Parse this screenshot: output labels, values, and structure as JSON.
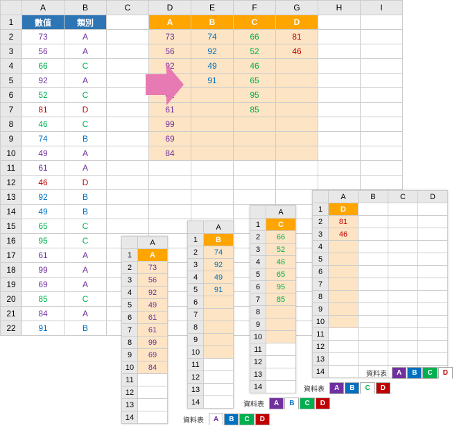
{
  "main": {
    "headers": [
      "數值",
      "類別"
    ],
    "cols": [
      "A",
      "B",
      "C",
      "D",
      "E",
      "F",
      "G",
      "H",
      "I"
    ],
    "rows": [
      {
        "n": "73",
        "c": "A"
      },
      {
        "n": "56",
        "c": "A"
      },
      {
        "n": "66",
        "c": "C"
      },
      {
        "n": "92",
        "c": "A"
      },
      {
        "n": "52",
        "c": "C"
      },
      {
        "n": "81",
        "c": "D"
      },
      {
        "n": "46",
        "c": "C"
      },
      {
        "n": "74",
        "c": "B"
      },
      {
        "n": "49",
        "c": "A"
      },
      {
        "n": "61",
        "c": "A"
      },
      {
        "n": "46",
        "c": "D"
      },
      {
        "n": "92",
        "c": "B"
      },
      {
        "n": "49",
        "c": "B"
      },
      {
        "n": "65",
        "c": "C"
      },
      {
        "n": "95",
        "c": "C"
      },
      {
        "n": "61",
        "c": "A"
      },
      {
        "n": "99",
        "c": "A"
      },
      {
        "n": "69",
        "c": "A"
      },
      {
        "n": "85",
        "c": "C"
      },
      {
        "n": "84",
        "c": "A"
      },
      {
        "n": "91",
        "c": "B"
      }
    ],
    "right_headers": [
      "A",
      "B",
      "C",
      "D"
    ],
    "right_data": [
      [
        "73",
        "74",
        "66",
        "81"
      ],
      [
        "56",
        "92",
        "52",
        "46"
      ],
      [
        "92",
        "49",
        "46",
        ""
      ],
      [
        "49",
        "91",
        "65",
        ""
      ],
      [
        "61",
        "",
        "95",
        ""
      ],
      [
        "61",
        "",
        "85",
        ""
      ],
      [
        "99",
        "",
        "",
        ""
      ],
      [
        "69",
        "",
        "",
        ""
      ],
      [
        "84",
        "",
        "",
        ""
      ]
    ]
  },
  "minis": [
    {
      "hdr": "A",
      "cls": "cA",
      "data": [
        "73",
        "56",
        "92",
        "49",
        "61",
        "61",
        "99",
        "69",
        "84"
      ]
    },
    {
      "hdr": "B",
      "cls": "cB",
      "data": [
        "74",
        "92",
        "49",
        "91"
      ]
    },
    {
      "hdr": "C",
      "cls": "cC",
      "data": [
        "66",
        "52",
        "46",
        "65",
        "95",
        "85"
      ]
    },
    {
      "hdr": "D",
      "cls": "cD",
      "data": [
        "81",
        "46"
      ]
    }
  ],
  "tab_label": "資料表",
  "tab_items": [
    "A",
    "B",
    "C",
    "D"
  ]
}
